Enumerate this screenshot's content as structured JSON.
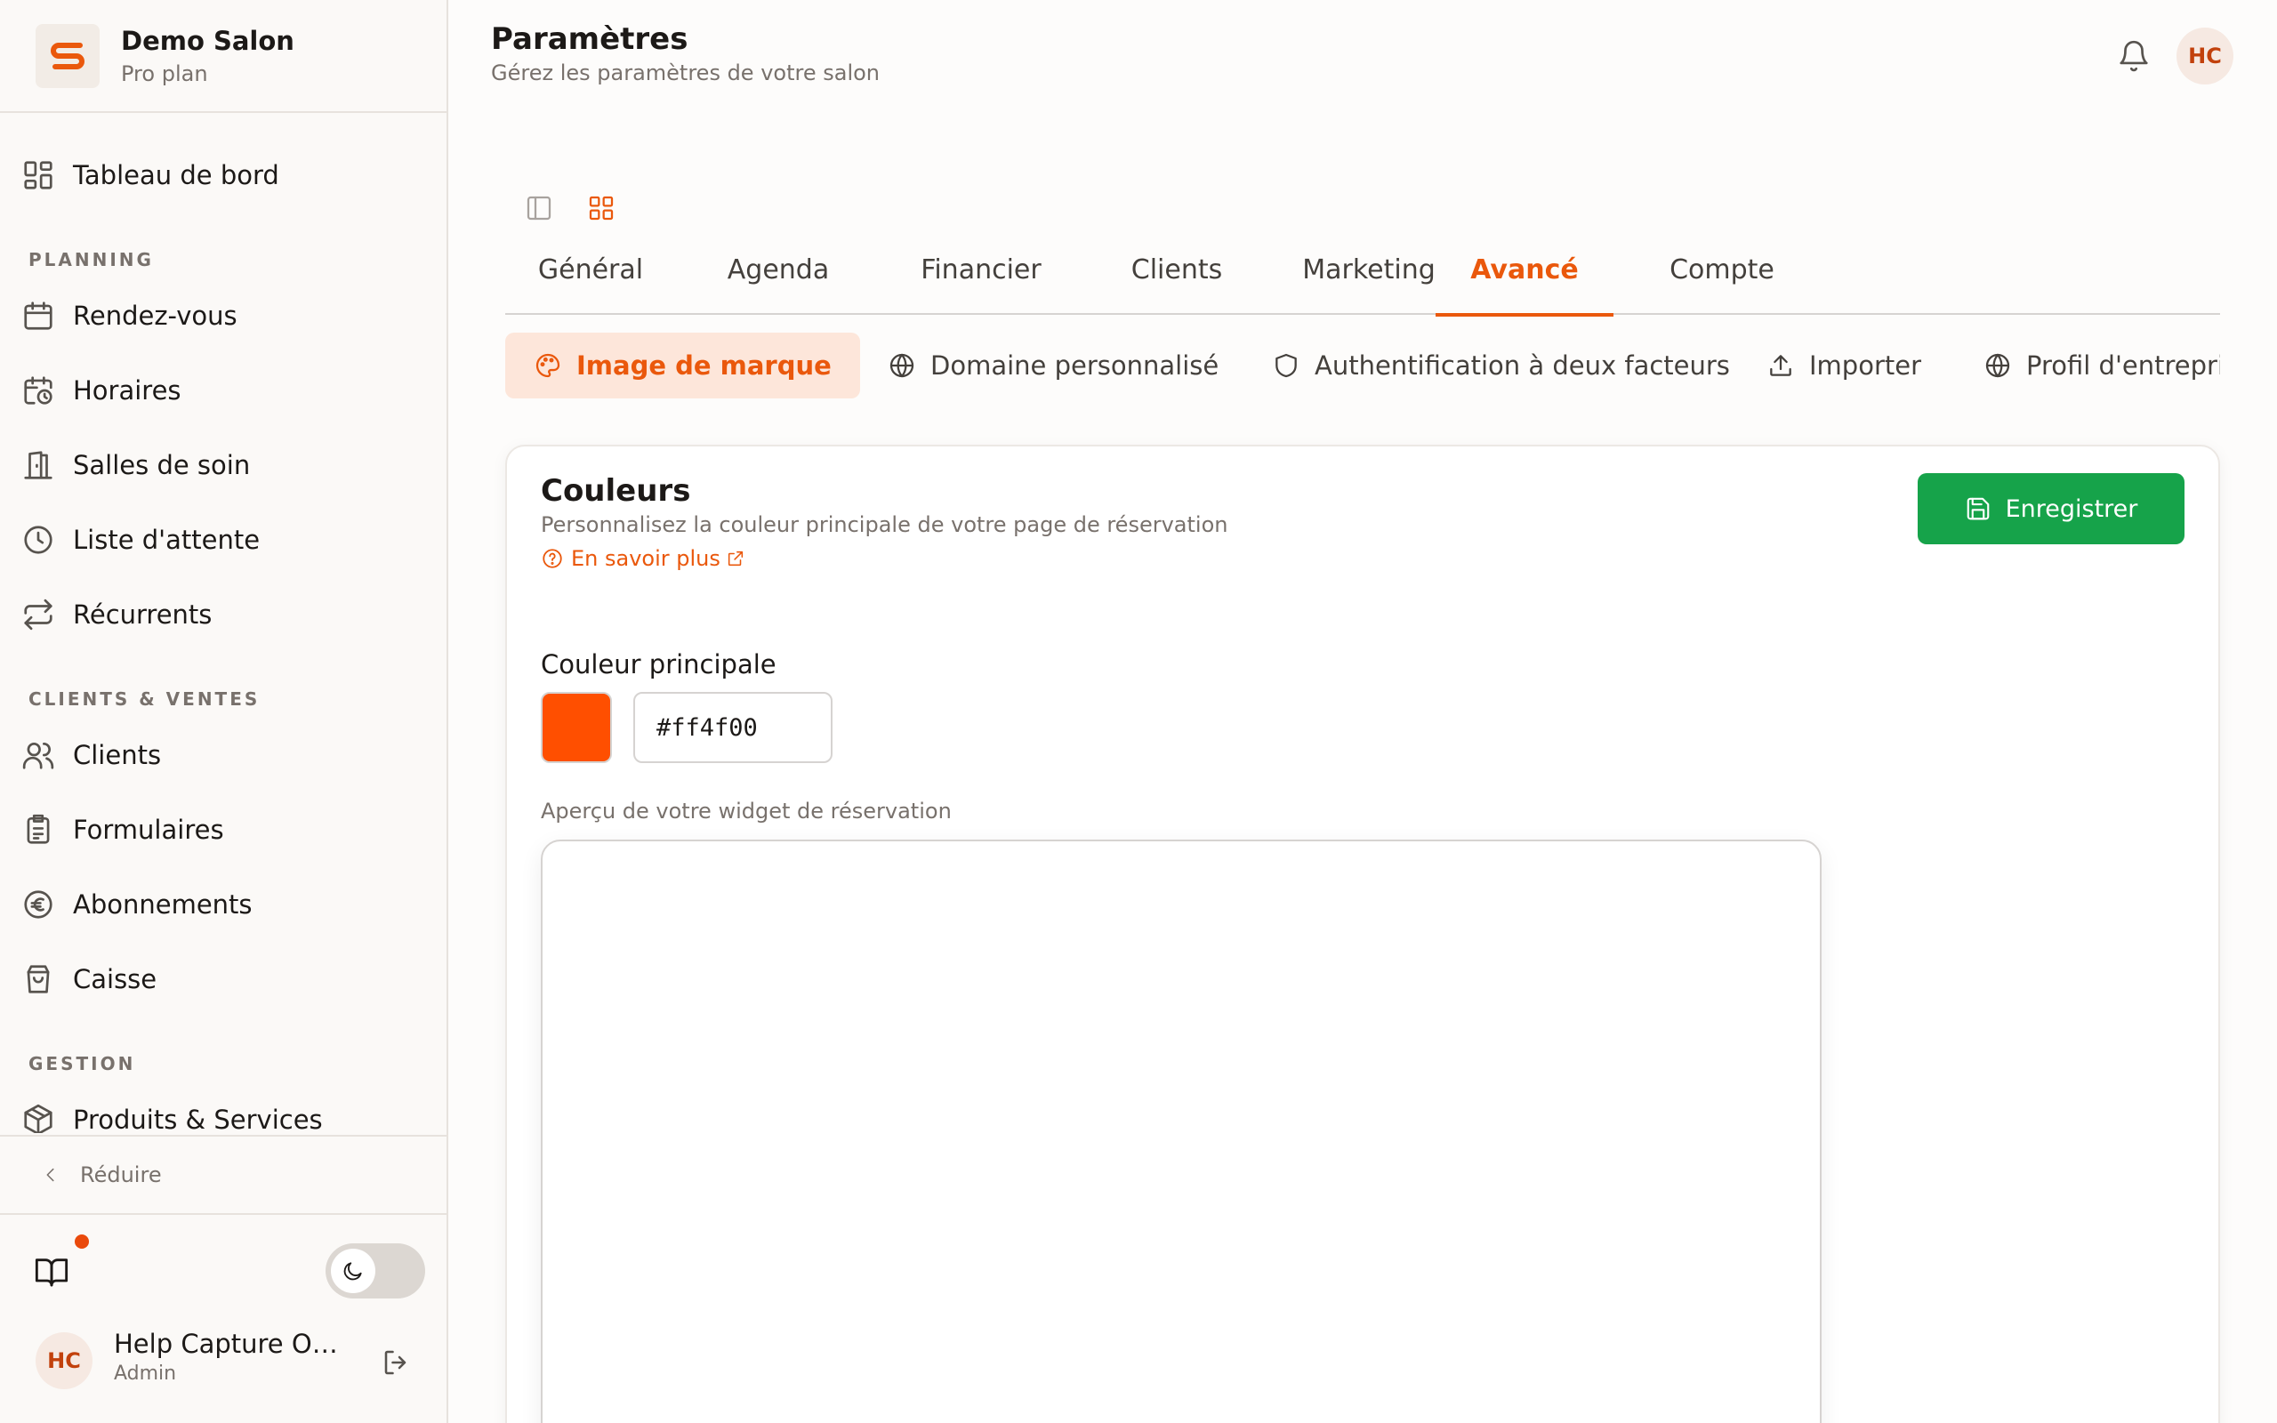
{
  "brand": {
    "name": "Demo Salon",
    "plan": "Pro plan",
    "logo_letter": "S",
    "accent": "#ea580c"
  },
  "sidebar": {
    "dashboard": {
      "label": "Tableau de bord",
      "icon": "dashboard-icon"
    },
    "sections": [
      {
        "title": "PLANNING",
        "items": [
          {
            "label": "Rendez-vous",
            "icon": "calendar-icon"
          },
          {
            "label": "Horaires",
            "icon": "calendar-clock-icon"
          },
          {
            "label": "Salles de soin",
            "icon": "door-icon"
          },
          {
            "label": "Liste d'attente",
            "icon": "clock-icon"
          },
          {
            "label": "Récurrents",
            "icon": "repeat-icon"
          }
        ]
      },
      {
        "title": "CLIENTS & VENTES",
        "items": [
          {
            "label": "Clients",
            "icon": "users-icon"
          },
          {
            "label": "Formulaires",
            "icon": "clipboard-icon"
          },
          {
            "label": "Abonnements",
            "icon": "euro-icon"
          },
          {
            "label": "Caisse",
            "icon": "shopping-bag-icon"
          }
        ]
      },
      {
        "title": "GESTION",
        "items": [
          {
            "label": "Produits & Services",
            "icon": "package-icon"
          }
        ]
      }
    ],
    "collapse_label": "Réduire",
    "user": {
      "initials": "HC",
      "name": "Help Capture Owner",
      "role": "Admin"
    }
  },
  "header": {
    "title": "Paramètres",
    "subtitle": "Gérez les paramètres de votre salon",
    "avatar_initials": "HC"
  },
  "tabs": [
    "Général",
    "Agenda",
    "Financier",
    "Clients",
    "Marketing",
    "Avancé",
    "Compte"
  ],
  "active_tab": "Avancé",
  "subtabs": [
    {
      "label": "Image de marque",
      "icon": "palette-icon",
      "active": true
    },
    {
      "label": "Domaine personnalisé",
      "icon": "globe-icon",
      "active": false
    },
    {
      "label": "Authentification à deux facteurs",
      "icon": "shield-icon",
      "active": false
    },
    {
      "label": "Importer",
      "icon": "upload-icon",
      "active": false
    },
    {
      "label": "Profil d'entreprise",
      "icon": "globe-icon",
      "active": false
    }
  ],
  "card": {
    "title": "Couleurs",
    "description": "Personnalisez la couleur principale de votre page de réservation",
    "learn_more": "En savoir plus",
    "save_label": "Enregistrer",
    "field_label": "Couleur principale",
    "color_value": "#ff4f00",
    "preview_label": "Aperçu de votre widget de réservation"
  }
}
